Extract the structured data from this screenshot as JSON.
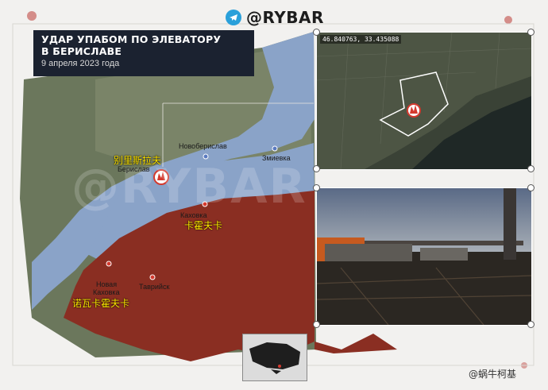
{
  "brand": {
    "handle": "@RYBAR",
    "icon": "telegram-icon"
  },
  "title": {
    "line1": "УДАР УПАБОМ ПО ЭЛЕВАТОРУ",
    "line2": "В БЕРИСЛАВЕ",
    "date": "9 апреля 2023 года"
  },
  "map": {
    "labels": {
      "novoberislav": "Новоберислав",
      "zmievka": "Змиевка",
      "berislav": "Берислав",
      "berislav_cn": "别里斯拉夫",
      "kakhovka": "Каховка",
      "kakhovka_cn": "卡霍夫卡",
      "nova_kakhovka_1": "Новая",
      "nova_kakhovka_2": "Каховка",
      "nova_kakhovka_cn": "诺瓦卡霍夫卡",
      "tavriysk": "Таврийск"
    },
    "strike_icon": "explosion-icon",
    "watermark": "@RYBAR"
  },
  "photo_top": {
    "coordinates": "46.840763, 33.435088"
  },
  "colors": {
    "controlled_zone": "#8a2e22",
    "water": "#8aa3c8",
    "land": "#6e7a5e",
    "title_bg": "#1b2230",
    "accent": "#d43a2f"
  },
  "watermark_footer": "@蜗牛柯基"
}
